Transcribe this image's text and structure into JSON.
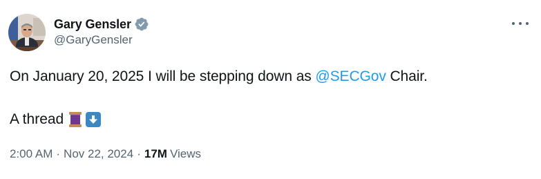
{
  "author": {
    "display_name": "Gary Gensler",
    "handle": "@GaryGensler",
    "verified_badge_color": "#829aab"
  },
  "tweet": {
    "text_before_mention": "On January 20, 2025 I will be stepping down as ",
    "mention": "@SECGov",
    "text_after_mention": " Chair.",
    "thread_text": "A thread",
    "emojis": [
      "spool-of-thread-emoji",
      "down-arrow-emoji"
    ]
  },
  "meta": {
    "time": "2:00 AM",
    "separator": "·",
    "date": "Nov 22, 2024",
    "views_count": "17M",
    "views_label": "Views"
  },
  "colors": {
    "text": "#0f1419",
    "secondary": "#536471",
    "link": "#1d9bf0"
  },
  "icons": {
    "more": "more-options-icon",
    "verified": "verified-badge-icon"
  }
}
